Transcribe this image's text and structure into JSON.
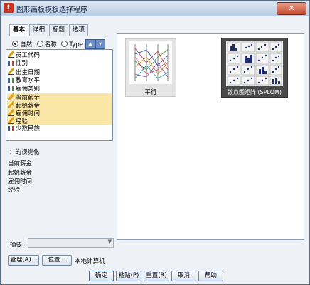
{
  "window": {
    "title": "图形画板模板选择程序",
    "close_label": "✕",
    "app_icon": "t"
  },
  "tabs": [
    {
      "label": "基本",
      "active": true
    },
    {
      "label": "详细",
      "active": false
    },
    {
      "label": "标题",
      "active": false
    },
    {
      "label": "选项",
      "active": false
    }
  ],
  "sort_options": [
    {
      "label": "自然",
      "selected": true
    },
    {
      "label": "名称",
      "selected": false
    },
    {
      "label": "Type",
      "selected": false
    }
  ],
  "variables": [
    {
      "name": "员工代码",
      "icon": "scale-icon",
      "selected": false
    },
    {
      "name": "性别",
      "icon": "nominal-icon",
      "selected": false
    },
    {
      "name": "出生日期",
      "icon": "scale-icon",
      "selected": false
    },
    {
      "name": "教育水平",
      "icon": "ordinal-icon",
      "selected": false
    },
    {
      "name": "雇佣类别",
      "icon": "ordinal-icon",
      "selected": false
    },
    {
      "name": "当前薪金",
      "icon": "scale-icon",
      "selected": true
    },
    {
      "name": "起始薪金",
      "icon": "scale-icon",
      "selected": true
    },
    {
      "name": "雇佣时间",
      "icon": "scale-icon",
      "selected": true
    },
    {
      "name": "经验",
      "icon": "scale-icon",
      "selected": true
    },
    {
      "name": "少数民族",
      "icon": "nominal-icon",
      "selected": false
    }
  ],
  "info": {
    "heading": "：的视觉化",
    "lines": [
      "当前薪金",
      "起始薪金",
      "雇佣时间",
      "经验"
    ]
  },
  "gallery": [
    {
      "label": "平行",
      "selected": false
    },
    {
      "label": "散点图矩阵 (SPLOM)",
      "selected": true
    }
  ],
  "summary": {
    "label": "摘要:",
    "value": ""
  },
  "buttons": {
    "manage": "管理(A)...",
    "location": "位置...",
    "ok": "确定",
    "paste": "粘贴(P)",
    "reset": "重置(R)",
    "cancel": "取消",
    "help": "帮助"
  },
  "local_label": "本地计算机"
}
